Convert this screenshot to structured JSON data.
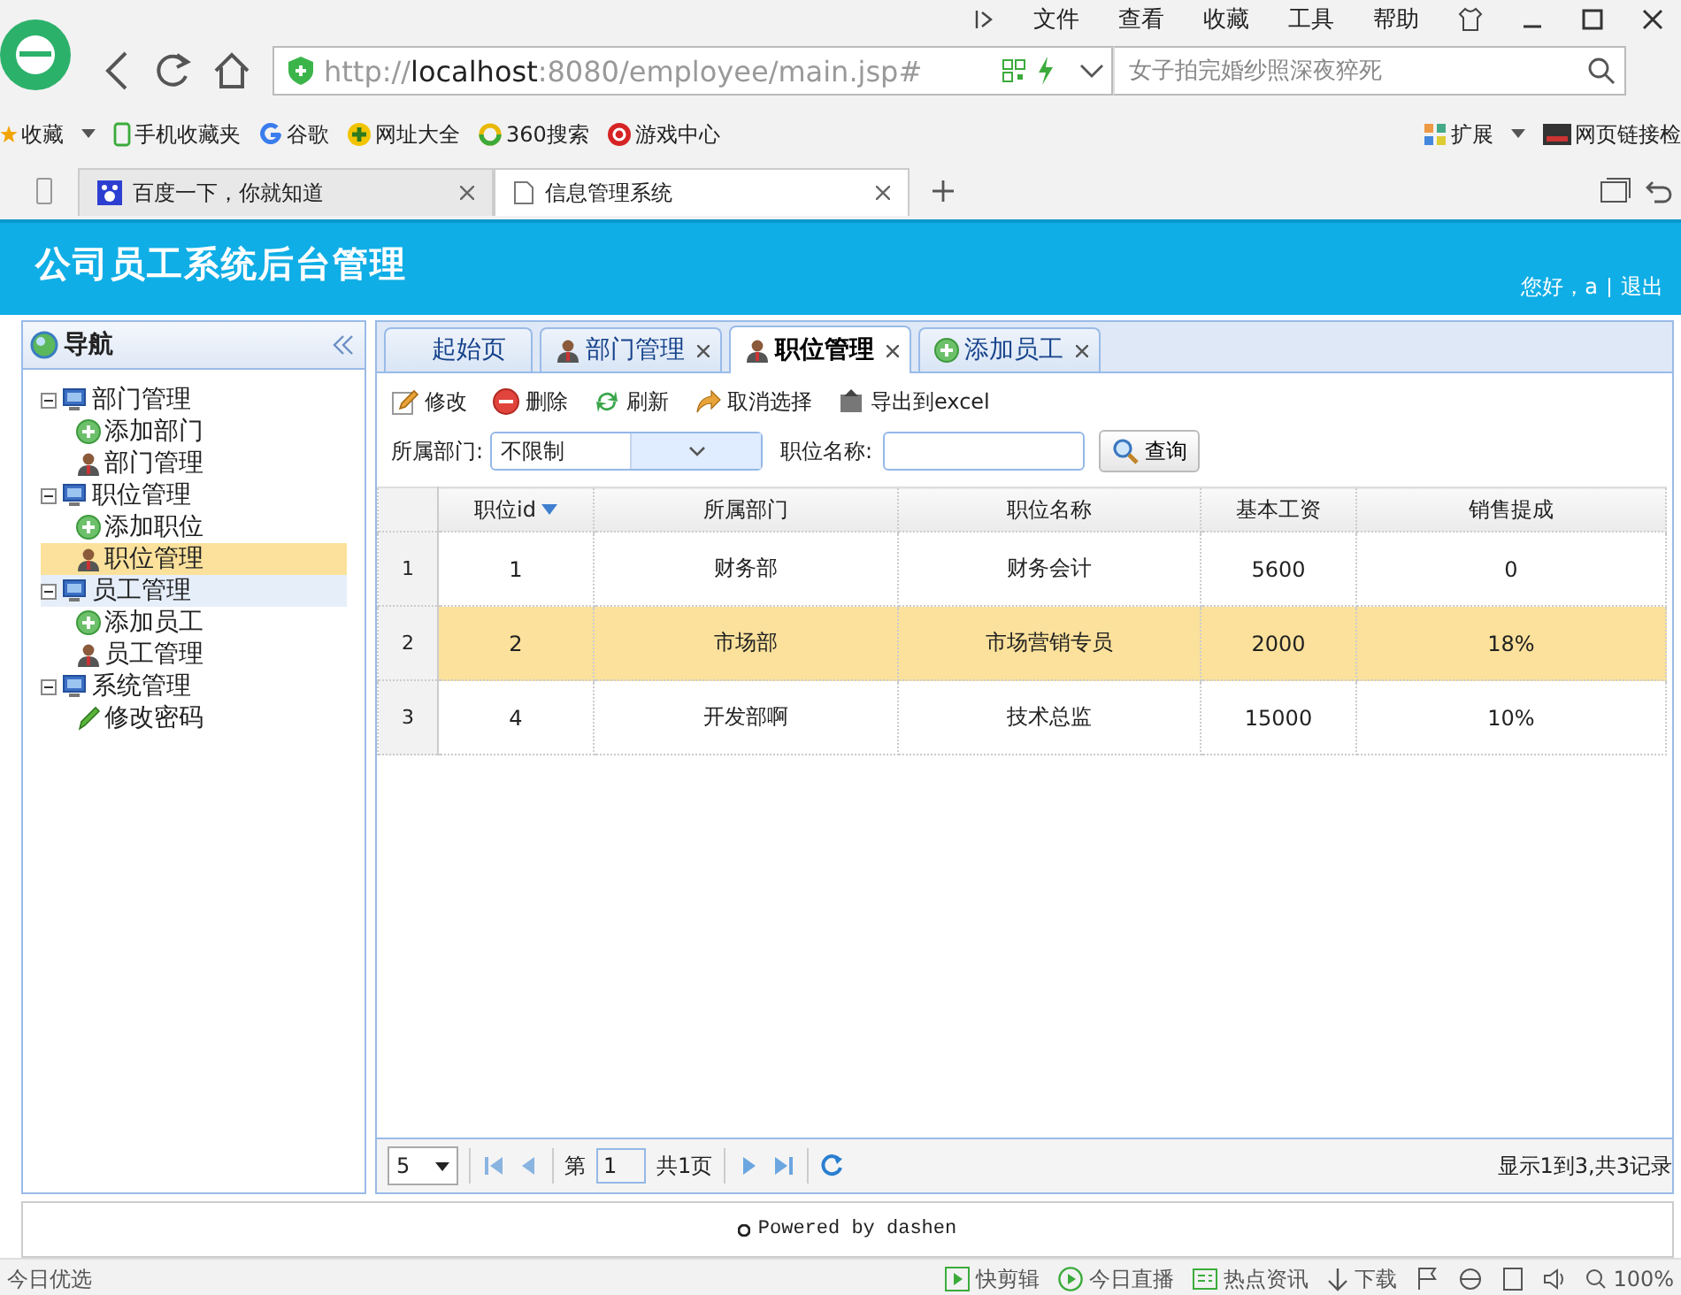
{
  "browser": {
    "menu": [
      "文件",
      "查看",
      "收藏",
      "工具",
      "帮助"
    ],
    "url": {
      "scheme": "http://",
      "host": "localhost",
      "rest": ":8080/employee/main.jsp#"
    },
    "search": {
      "placeholder": "女子拍完婚纱照深夜猝死"
    },
    "bookmarks": [
      {
        "label": "收藏",
        "kind": "star"
      },
      {
        "label": "手机收藏夹",
        "kind": "phone"
      },
      {
        "label": "谷歌",
        "kind": "g"
      },
      {
        "label": "网址大全",
        "kind": "plus"
      },
      {
        "label": "360搜索",
        "kind": "ring"
      },
      {
        "label": "游戏中心",
        "kind": "game"
      }
    ],
    "bookmarks_right": [
      {
        "label": "扩展",
        "kind": "grid"
      },
      {
        "label": "网页链接检",
        "kind": "link"
      }
    ],
    "tabs": [
      {
        "label": "百度一下，你就知道",
        "selected": false
      },
      {
        "label": "信息管理系统",
        "selected": true
      }
    ]
  },
  "header": {
    "title": "公司员工系统后台管理",
    "greeting": "您好，a",
    "logout": "退出"
  },
  "nav": {
    "title": "导航",
    "tree": [
      {
        "label": "部门管理",
        "expanded": true,
        "hovered": false,
        "selected": false,
        "children": [
          {
            "label": "添加部门",
            "kind": "add",
            "selected": false
          },
          {
            "label": "部门管理",
            "kind": "user",
            "selected": false
          }
        ]
      },
      {
        "label": "职位管理",
        "expanded": true,
        "hovered": false,
        "selected": false,
        "children": [
          {
            "label": "添加职位",
            "kind": "add",
            "selected": false
          },
          {
            "label": "职位管理",
            "kind": "user",
            "selected": true
          }
        ]
      },
      {
        "label": "员工管理",
        "expanded": true,
        "hovered": true,
        "selected": false,
        "children": [
          {
            "label": "添加员工",
            "kind": "add",
            "selected": false
          },
          {
            "label": "员工管理",
            "kind": "user",
            "selected": false
          }
        ]
      },
      {
        "label": "系统管理",
        "expanded": true,
        "hovered": false,
        "selected": false,
        "children": [
          {
            "label": "修改密码",
            "kind": "pencil",
            "selected": false
          }
        ]
      }
    ]
  },
  "tabs": [
    {
      "label": "起始页",
      "kind": "plain",
      "closable": false,
      "selected": false
    },
    {
      "label": "部门管理",
      "kind": "user",
      "closable": true,
      "selected": false
    },
    {
      "label": "职位管理",
      "kind": "user",
      "closable": true,
      "selected": true
    },
    {
      "label": "添加员工",
      "kind": "add",
      "closable": true,
      "selected": false
    }
  ],
  "toolbar": [
    {
      "label": "修改",
      "kind": "edit"
    },
    {
      "label": "删除",
      "kind": "delete"
    },
    {
      "label": "刷新",
      "kind": "refresh"
    },
    {
      "label": "取消选择",
      "kind": "undo"
    },
    {
      "label": "导出到excel",
      "kind": "export"
    }
  ],
  "filters": {
    "department_label": "所属部门:",
    "department_value": "不限制",
    "name_label": "职位名称:",
    "search_button": "查询"
  },
  "table": {
    "columns": [
      {
        "label": "职位id",
        "sorted": true
      },
      {
        "label": "所属部门",
        "sorted": false
      },
      {
        "label": "职位名称",
        "sorted": false
      },
      {
        "label": "基本工资",
        "sorted": false
      },
      {
        "label": "销售提成",
        "sorted": false
      }
    ],
    "rows": [
      {
        "number": "1",
        "cells": [
          "1",
          "财务部",
          "财务会计",
          "5600",
          "0"
        ],
        "selected": false
      },
      {
        "number": "2",
        "cells": [
          "2",
          "市场部",
          "市场营销专员",
          "2000",
          "18%"
        ],
        "selected": true
      },
      {
        "number": "3",
        "cells": [
          "4",
          "开发部啊",
          "技术总监",
          "15000",
          "10%"
        ],
        "selected": false
      }
    ]
  },
  "pager": {
    "page_size": "5",
    "page_prefix": "第",
    "page": "1",
    "page_total": "共1页",
    "summary": "显示1到3,共3记录"
  },
  "footer": "Powered by dashen",
  "status_bar": {
    "left": "今日优选",
    "items": [
      {
        "label": "快剪辑",
        "kind": "clip"
      },
      {
        "label": "今日直播",
        "kind": "play"
      },
      {
        "label": "热点资讯",
        "kind": "news"
      },
      {
        "label": "下载",
        "kind": "download"
      }
    ],
    "zoom": "100%"
  }
}
